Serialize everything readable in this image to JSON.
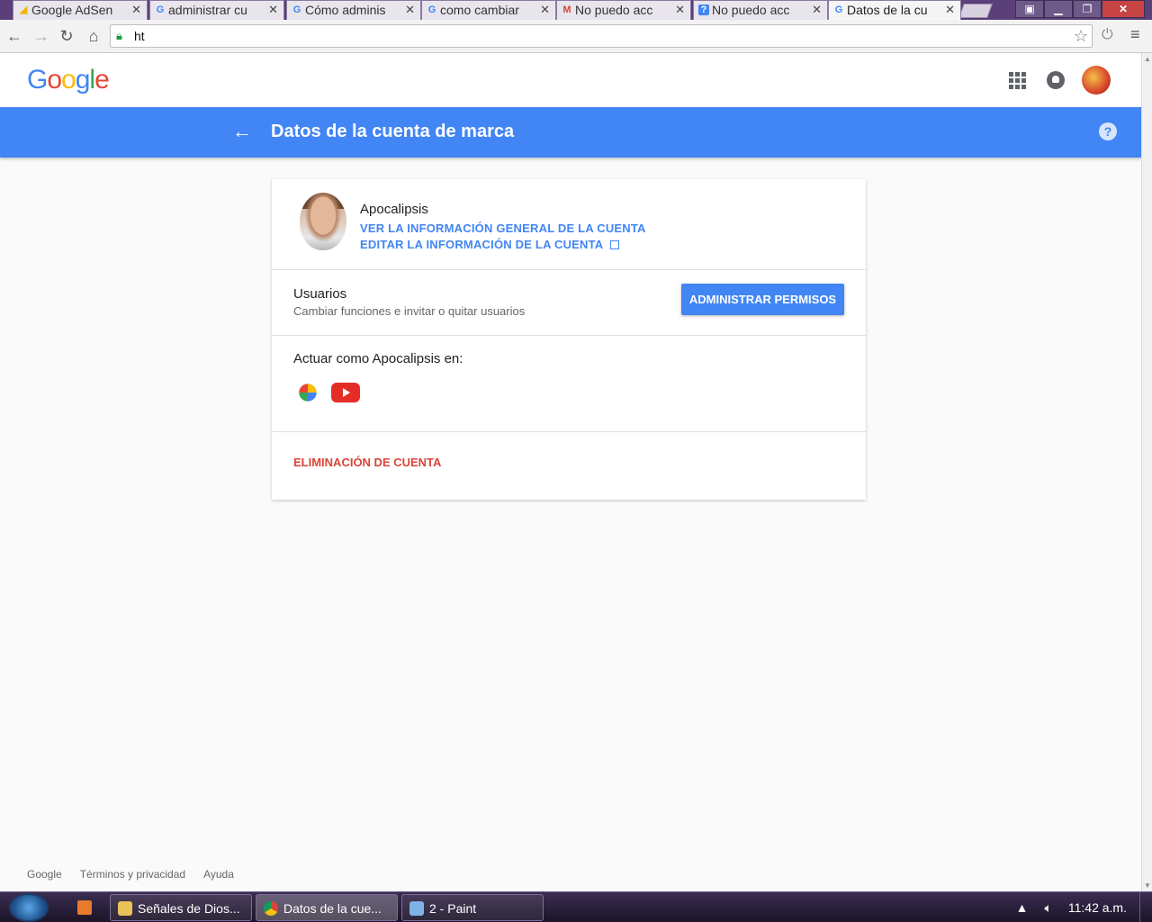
{
  "browser": {
    "tabs": [
      {
        "label": "Google AdSen",
        "icon": "adsense-icon"
      },
      {
        "label": "administrar cu",
        "icon": "google-g-icon"
      },
      {
        "label": "Cómo adminis",
        "icon": "google-g-icon"
      },
      {
        "label": "como cambiar",
        "icon": "google-g-icon"
      },
      {
        "label": "No puedo acc",
        "icon": "gmail-icon"
      },
      {
        "label": "No puedo acc",
        "icon": "support-icon"
      },
      {
        "label": "Datos de la cu",
        "icon": "google-g-icon"
      }
    ],
    "url": "ht"
  },
  "header": {
    "logo": "Google",
    "icons": [
      "apps-icon",
      "notifications-icon",
      "account-avatar"
    ]
  },
  "bluebar": {
    "title": "Datos de la cuenta de marca",
    "help": "?"
  },
  "card": {
    "profile_name": "Apocalipsis",
    "link_overview": "VER LA INFORMACIÓN GENERAL DE LA CUENTA",
    "link_edit": "EDITAR LA INFORMACIÓN DE LA CUENTA",
    "users_title": "Usuarios",
    "users_subtitle": "Cambiar funciones e invitar o quitar usuarios",
    "admin_button": "ADMINISTRAR PERMISOS",
    "act_as": "Actuar como Apocalipsis en:",
    "services": [
      "google-photos-icon",
      "youtube-icon"
    ],
    "delete_link": "ELIMINACIÓN DE CUENTA"
  },
  "footer": {
    "links": [
      "Google",
      "Términos y privacidad",
      "Ayuda"
    ]
  },
  "taskbar": {
    "tasks": [
      "Señales de Dios...",
      "Datos de la cue...",
      "2 - Paint"
    ],
    "clock": "11:42 a.m."
  },
  "colors": {
    "accent": "#4285f4",
    "danger": "#db4437"
  }
}
